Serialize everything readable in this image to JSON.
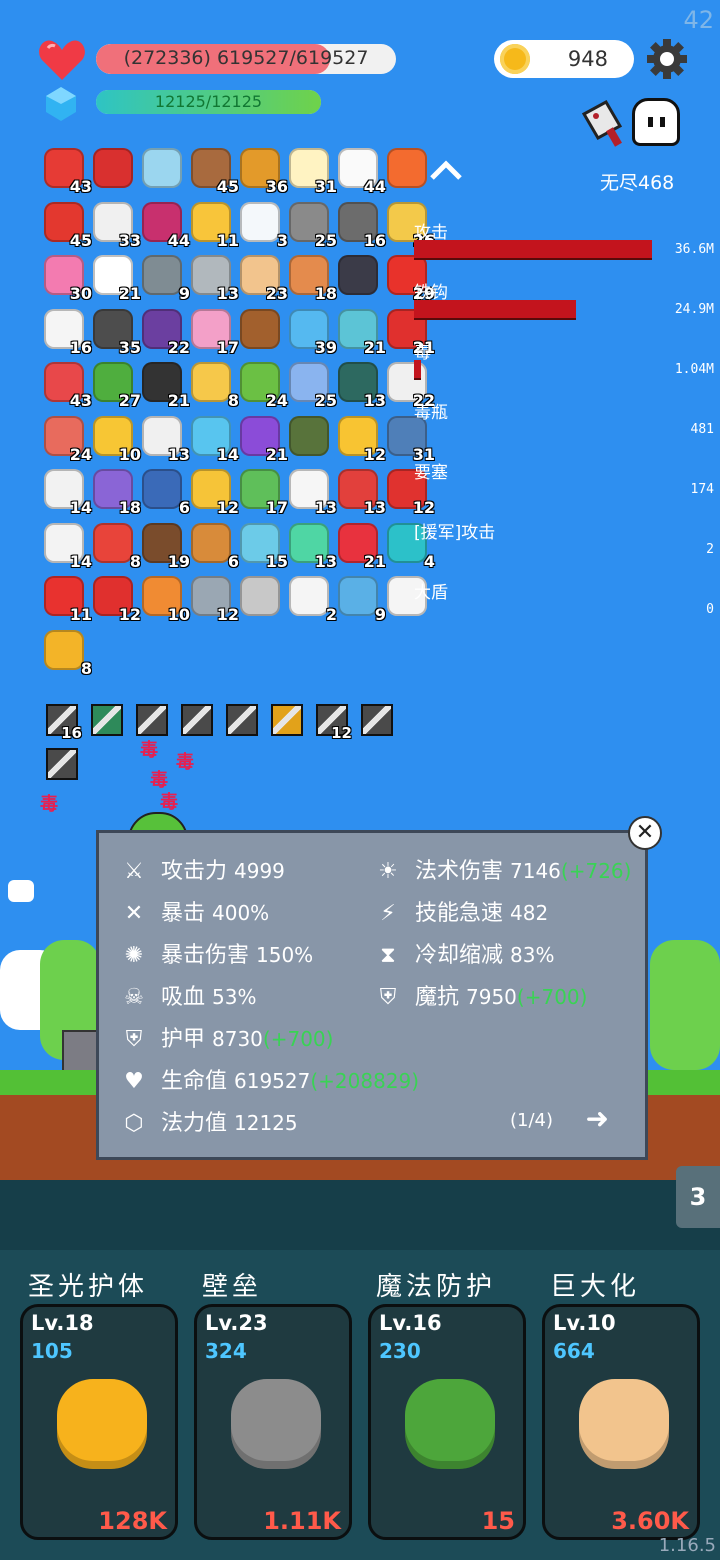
{
  "fps": "42",
  "hp": {
    "text": "(272336) 619527/619527",
    "fill": 0.78
  },
  "mana": {
    "text": "12125/12125",
    "fill": 1.0
  },
  "coins": "948",
  "endless": "无尽468",
  "items": [
    {
      "icon": "apple-icon",
      "count": "43",
      "color": "#e63b35"
    },
    {
      "icon": "magnet-icon",
      "count": "",
      "color": "#d9302f"
    },
    {
      "icon": "magnifier-icon",
      "count": "",
      "color": "#9bd6ef"
    },
    {
      "icon": "shield-round-icon",
      "count": "45",
      "color": "#a86a3e"
    },
    {
      "icon": "book-icon",
      "count": "36",
      "color": "#e39a2a"
    },
    {
      "icon": "egg-icon",
      "count": "31",
      "color": "#fff3c2"
    },
    {
      "icon": "flower-icon",
      "count": "44",
      "color": "#fafafa"
    },
    {
      "icon": "crown-icon",
      "count": "",
      "color": "#f36b2f"
    },
    {
      "icon": "sock-icon",
      "count": "45",
      "color": "#e3382f"
    },
    {
      "icon": "pill-icon",
      "count": "33",
      "color": "#f0f0f0"
    },
    {
      "icon": "jam-icon",
      "count": "44",
      "color": "#c8306e"
    },
    {
      "icon": "sun-cloud-icon",
      "count": "11",
      "color": "#f8c53a"
    },
    {
      "icon": "cloud-icon",
      "count": "3",
      "color": "#f4f8fb"
    },
    {
      "icon": "sword-icon",
      "count": "25",
      "color": "#8a8a8a"
    },
    {
      "icon": "meteor-icon",
      "count": "16",
      "color": "#6c6c6c"
    },
    {
      "icon": "scroll-icon",
      "count": "26",
      "color": "#f3c94a"
    },
    {
      "icon": "potion-icon",
      "count": "30",
      "color": "#f37bb0"
    },
    {
      "icon": "cloud-white-icon",
      "count": "21",
      "color": "#ffffff"
    },
    {
      "icon": "compass-icon",
      "count": "9",
      "color": "#7f8c93"
    },
    {
      "icon": "mace-icon",
      "count": "13",
      "color": "#b1b8bd"
    },
    {
      "icon": "glove-icon",
      "count": "23",
      "color": "#f2c48d"
    },
    {
      "icon": "flag-icon",
      "count": "18",
      "color": "#e48b4d"
    },
    {
      "icon": "bat-icon",
      "count": "",
      "color": "#3b3b48"
    },
    {
      "icon": "mushroom-icon",
      "count": "29",
      "color": "#e8322b"
    },
    {
      "icon": "cards-icon",
      "count": "16",
      "color": "#f5f5f5"
    },
    {
      "icon": "helmet-icon",
      "count": "35",
      "color": "#4d4d4d"
    },
    {
      "icon": "box-icon",
      "count": "22",
      "color": "#6b3fa0"
    },
    {
      "icon": "icecream-icon",
      "count": "17",
      "color": "#f3a0c8"
    },
    {
      "icon": "chest-icon",
      "count": "",
      "color": "#a2602d"
    },
    {
      "icon": "star-card-icon",
      "count": "39",
      "color": "#55b9f0"
    },
    {
      "icon": "paper-icon",
      "count": "21",
      "color": "#5cc4d6"
    },
    {
      "icon": "strawberry-icon",
      "count": "21",
      "color": "#e0302e"
    },
    {
      "icon": "watermelon-icon",
      "count": "43",
      "color": "#e8484a"
    },
    {
      "icon": "leaf-icon",
      "count": "27",
      "color": "#4fae3e"
    },
    {
      "icon": "cauldron-icon",
      "count": "21",
      "color": "#333333"
    },
    {
      "icon": "ring-icon",
      "count": "8",
      "color": "#f6c84a"
    },
    {
      "icon": "frog-icon",
      "count": "24",
      "color": "#6bc044"
    },
    {
      "icon": "capsule-icon",
      "count": "25",
      "color": "#8ab4ef"
    },
    {
      "icon": "disc-icon",
      "count": "13",
      "color": "#2d6960"
    },
    {
      "icon": "clipboard-icon",
      "count": "22",
      "color": "#f0f0f0"
    },
    {
      "icon": "meat-icon",
      "count": "24",
      "color": "#e86b5d"
    },
    {
      "icon": "wand-icon",
      "count": "10",
      "color": "#f7c634"
    },
    {
      "icon": "thermometer-icon",
      "count": "13",
      "color": "#f0f0f0"
    },
    {
      "icon": "chat-bubble-icon",
      "count": "14",
      "color": "#58c5ef"
    },
    {
      "icon": "orb-icon",
      "count": "21",
      "color": "#8b4cd8"
    },
    {
      "icon": "grenade-icon",
      "count": "",
      "color": "#58733b"
    },
    {
      "icon": "sunflower-icon",
      "count": "12",
      "color": "#f8c432"
    },
    {
      "icon": "shield-blue-icon",
      "count": "31",
      "color": "#4f7fb8"
    },
    {
      "icon": "envelope-icon",
      "count": "14",
      "color": "#f2f2f2"
    },
    {
      "icon": "shield-purple-icon",
      "count": "18",
      "color": "#8a65d6"
    },
    {
      "icon": "mustache-icon",
      "count": "6",
      "color": "#3a6ab8"
    },
    {
      "icon": "crown-gold-icon",
      "count": "12",
      "color": "#f6c438"
    },
    {
      "icon": "money-icon",
      "count": "17",
      "color": "#5fbf5a"
    },
    {
      "icon": "bulb-icon",
      "count": "13",
      "color": "#f6f6f6"
    },
    {
      "icon": "banner-icon",
      "count": "13",
      "color": "#e2403c"
    },
    {
      "icon": "hook-icon",
      "count": "12",
      "color": "#e0322f"
    },
    {
      "icon": "dice-icon",
      "count": "14",
      "color": "#f3f3f3"
    },
    {
      "icon": "gift-icon",
      "count": "8",
      "color": "#e8443a"
    },
    {
      "icon": "coconut-icon",
      "count": "19",
      "color": "#7a4c2c"
    },
    {
      "icon": "bow-icon",
      "count": "6",
      "color": "#d88b3a"
    },
    {
      "icon": "syringe-icon",
      "count": "15",
      "color": "#6ccbe8"
    },
    {
      "icon": "spirit-icon",
      "count": "13",
      "color": "#4fd6a4"
    },
    {
      "icon": "heart-item-icon",
      "count": "21",
      "color": "#e8323e"
    },
    {
      "icon": "gem-icon",
      "count": "4",
      "color": "#2cc1c9"
    },
    {
      "icon": "bookmark-icon",
      "count": "11",
      "color": "#e8322f"
    },
    {
      "icon": "heart-break-icon",
      "count": "12",
      "color": "#e0302e"
    },
    {
      "icon": "scroll-orange-icon",
      "count": "10",
      "color": "#f08b33"
    },
    {
      "icon": "elephant-icon",
      "count": "12",
      "color": "#9aa7b3"
    },
    {
      "icon": "necklace-icon",
      "count": "",
      "color": "#c8c8c8"
    },
    {
      "icon": "speech-icon",
      "count": "2",
      "color": "#f5f5f5"
    },
    {
      "icon": "target-icon",
      "count": "9",
      "color": "#5ab0e6"
    },
    {
      "icon": "ghost-item-icon",
      "count": "",
      "color": "#f5f5f5"
    },
    {
      "icon": "coins-stack-icon",
      "count": "8",
      "color": "#f3b428"
    }
  ],
  "damage_stats": [
    {
      "label": "攻击",
      "value": "36.6M",
      "fill": 1.0
    },
    {
      "label": "铁钩",
      "value": "24.9M",
      "fill": 0.68
    },
    {
      "label": "毒",
      "value": "1.04M",
      "fill": 0.03
    },
    {
      "label": "毒瓶",
      "value": "481",
      "fill": 0.0
    },
    {
      "label": "要塞",
      "value": "174",
      "fill": 0.0
    },
    {
      "label": "[援军]攻击",
      "value": "2",
      "fill": 0.0
    },
    {
      "label": "大盾",
      "value": "0",
      "fill": 0.0
    }
  ],
  "equipment": [
    {
      "icon": "blade-icon",
      "count": "16"
    },
    {
      "icon": "glow-icon",
      "count": ""
    },
    {
      "icon": "blade-icon",
      "count": ""
    },
    {
      "icon": "blade-icon",
      "count": ""
    },
    {
      "icon": "blade-dark-icon",
      "count": ""
    },
    {
      "icon": "armor-gold-icon",
      "count": ""
    },
    {
      "icon": "blade-icon",
      "count": "12"
    },
    {
      "icon": "block-icon",
      "count": ""
    },
    {
      "icon": "herb-icon",
      "count": ""
    }
  ],
  "combat_text": [
    "毒",
    "毒",
    "毒",
    "毒",
    "毒"
  ],
  "stats": {
    "left": [
      {
        "icon": "axe-icon",
        "glyph": "⚔",
        "label": "攻击力",
        "value": "4999",
        "bonus": ""
      },
      {
        "icon": "crit-icon",
        "glyph": "✕",
        "label": "暴击",
        "value": "400%",
        "bonus": ""
      },
      {
        "icon": "crit-damage-icon",
        "glyph": "✺",
        "label": "暴击伤害",
        "value": "150%",
        "bonus": ""
      },
      {
        "icon": "lifesteal-icon",
        "glyph": "☠",
        "label": "吸血",
        "value": "53%",
        "bonus": ""
      },
      {
        "icon": "armor-icon",
        "glyph": "⛨",
        "label": "护甲",
        "value": "8730",
        "bonus": "(+700)"
      },
      {
        "icon": "health-icon",
        "glyph": "♥",
        "label": "生命值",
        "value": "619527",
        "bonus": "(+208829)"
      },
      {
        "icon": "mana-crystal-icon",
        "glyph": "⬡",
        "label": "法力值",
        "value": "12125",
        "bonus": ""
      }
    ],
    "right": [
      {
        "icon": "spell-damage-icon",
        "glyph": "☀",
        "label": "法术伤害",
        "value": "7146",
        "bonus": "(+726)"
      },
      {
        "icon": "haste-icon",
        "glyph": "⚡",
        "label": "技能急速",
        "value": "482",
        "bonus": ""
      },
      {
        "icon": "cooldown-icon",
        "glyph": "⧗",
        "label": "冷却缩减",
        "value": "83%",
        "bonus": ""
      },
      {
        "icon": "magic-resist-icon",
        "glyph": "⛨",
        "label": "魔抗",
        "value": "7950",
        "bonus": "(+700)"
      }
    ],
    "page": "(1/4)"
  },
  "side_tab": "3",
  "skills": [
    {
      "name": "圣光护体",
      "level": "Lv.18",
      "value": "105",
      "cost": "128K",
      "icon": "holy-light-icon",
      "color": "#f7b21c"
    },
    {
      "name": "壁垒",
      "level": "Lv.23",
      "value": "324",
      "cost": "1.11K",
      "icon": "rampart-armor-icon",
      "color": "#8c8c8c"
    },
    {
      "name": "魔法防护",
      "level": "Lv.16",
      "value": "230",
      "cost": "15",
      "icon": "magic-leaf-icon",
      "color": "#4da63b"
    },
    {
      "name": "巨大化",
      "level": "Lv.10",
      "value": "664",
      "cost": "3.60K",
      "icon": "giant-fist-icon",
      "color": "#f2c48d"
    }
  ],
  "version": "1.16.5"
}
